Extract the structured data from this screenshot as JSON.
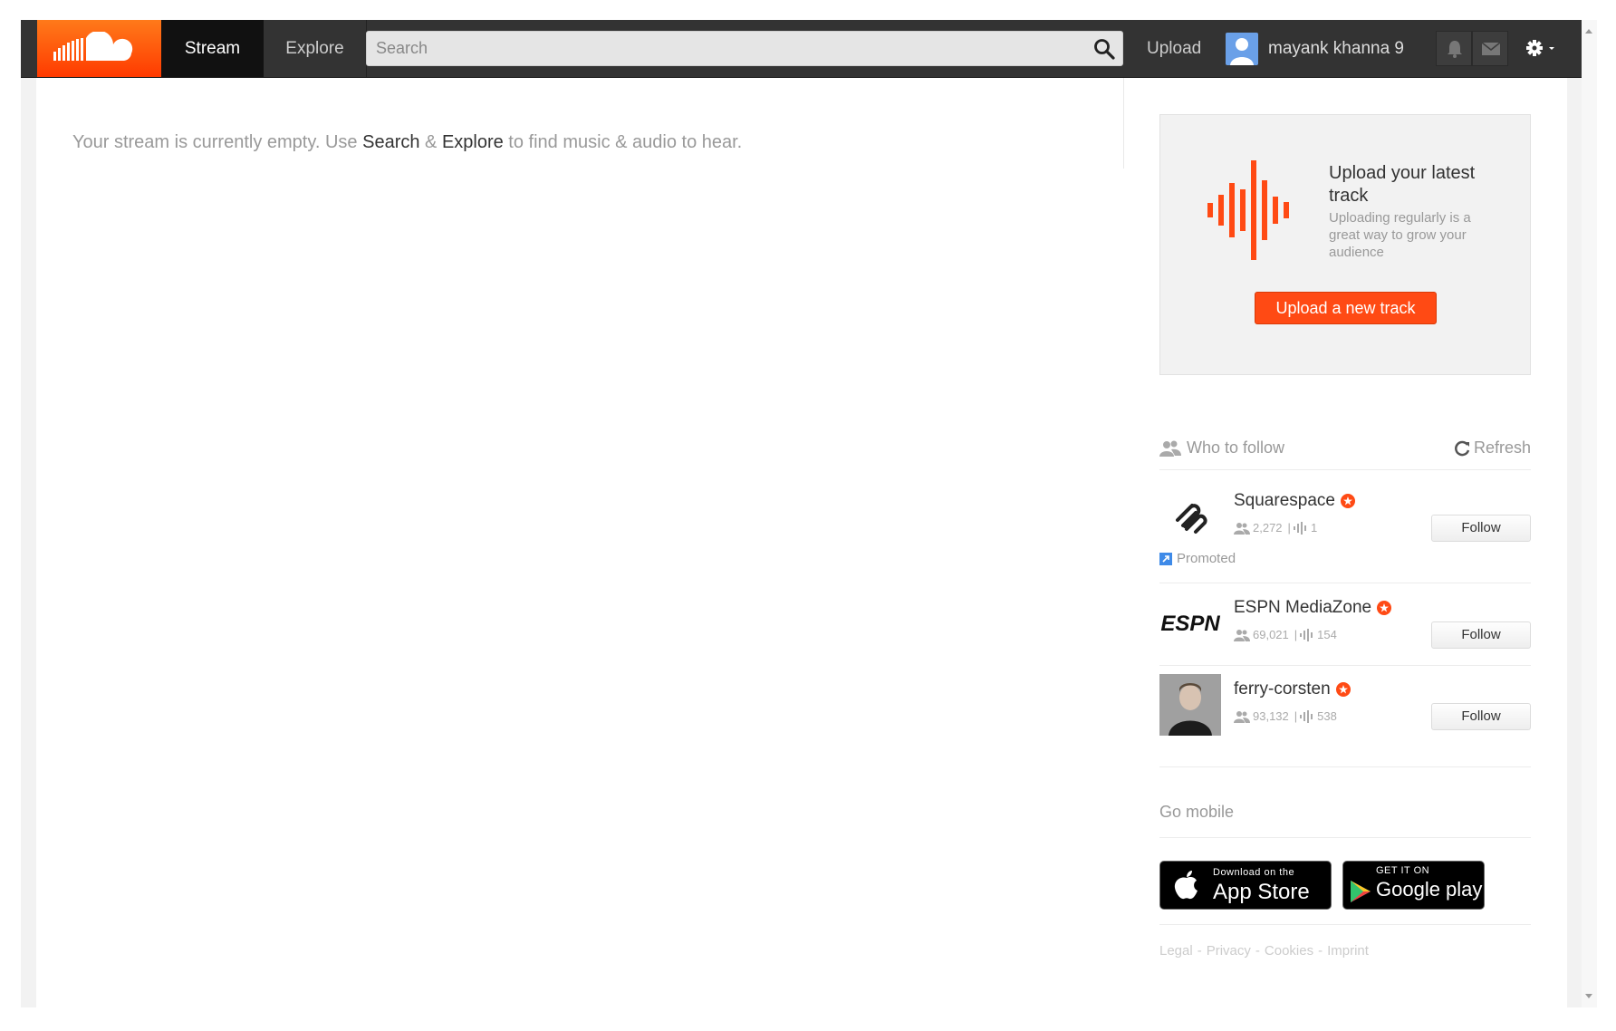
{
  "topbar": {
    "logo_name": "soundcloud-logo",
    "nav": {
      "stream": "Stream",
      "explore": "Explore"
    },
    "search_placeholder": "Search",
    "upload": "Upload",
    "username": "mayank khanna 9"
  },
  "stream": {
    "empty_prefix": "Your stream is currently empty. Use ",
    "search_link": "Search",
    "amp1": " & ",
    "explore_link": "Explore",
    "empty_suffix": " to find music & audio to hear."
  },
  "upload_card": {
    "title": "Upload your latest track",
    "subtitle": "Uploading regularly is a great way to grow your audience",
    "button": "Upload a new track"
  },
  "who_to_follow": {
    "title": "Who to follow",
    "refresh": "Refresh",
    "items": [
      {
        "name": "Squarespace",
        "followers": "2,272",
        "tracks": "1",
        "button": "Follow",
        "promoted": "Promoted"
      },
      {
        "name": "ESPN MediaZone",
        "followers": "69,021",
        "tracks": "154",
        "button": "Follow"
      },
      {
        "name": "ferry-corsten",
        "followers": "93,132",
        "tracks": "538",
        "button": "Follow"
      }
    ]
  },
  "go_mobile": {
    "title": "Go mobile",
    "appstore_small": "Download on the",
    "appstore_big": "App Store",
    "gplay_small": "GET IT ON",
    "gplay_big": "Google play"
  },
  "footer": {
    "legal": "Legal",
    "privacy": "Privacy",
    "cookies": "Cookies",
    "imprint": "Imprint"
  },
  "colors": {
    "accent": "#ff4a14",
    "topbar": "#333333"
  }
}
